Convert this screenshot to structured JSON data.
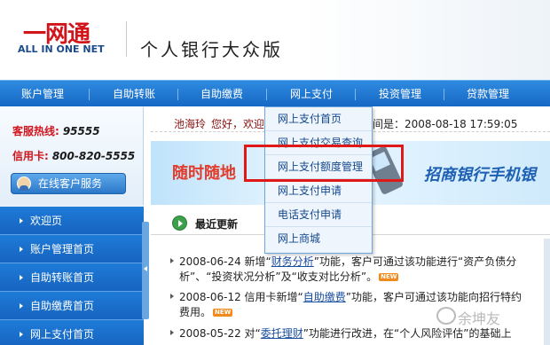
{
  "header": {
    "logo_cn": "一网通",
    "logo_en": "ALL IN ONE NET",
    "site_title": "个人银行大众版"
  },
  "nav": {
    "items": [
      "账户管理",
      "自助转账",
      "自助缴费",
      "网上支付",
      "投资管理",
      "贷款管理"
    ]
  },
  "sidebar": {
    "service_label": "客服热线:",
    "service_number": "95555",
    "card_label": "信用卡:",
    "card_number": "800-820-5555",
    "online_button": "在线客户服务",
    "menu": [
      "欢迎页",
      "账户管理首页",
      "自助转账首页",
      "自助缴费首页",
      "网上支付首页"
    ]
  },
  "welcome": {
    "user": "池海玲",
    "greeting": "您好，欢迎",
    "login_time": "间是：2008-08-18 17:59:05"
  },
  "banner": {
    "left_text": "随时随地",
    "right_text": "招商银行手机银"
  },
  "news": {
    "title": "最近更新",
    "lines": [
      {
        "pre": "2008-06-24 新增“",
        "link": "财务分析",
        "post": "”功能，客户可通过该功能进行“资产负债分"
      },
      {
        "pre": "析”、“投资状况分析”及“收支对比分析”。",
        "link": "",
        "post": ""
      },
      {
        "pre": "2008-06-12 信用卡新增“",
        "link": "自助缴费",
        "post": "”功能，客户可通过该功能向招行特约"
      },
      {
        "pre": "费用。",
        "link": "",
        "post": ""
      },
      {
        "pre": "2008-05-22 对“",
        "link": "委托理财",
        "post": "”功能进行改进，在“个人风险评估”的基础上"
      }
    ],
    "new_badge": "NEW"
  },
  "dropdown": {
    "items": [
      "网上支付首页",
      "网上支付交易查询",
      "网上支付额度管理",
      "网上支付申请",
      "电话支付申请",
      "网上商城"
    ],
    "highlighted": "网上支付额度管理"
  },
  "watermark": "余坤友"
}
